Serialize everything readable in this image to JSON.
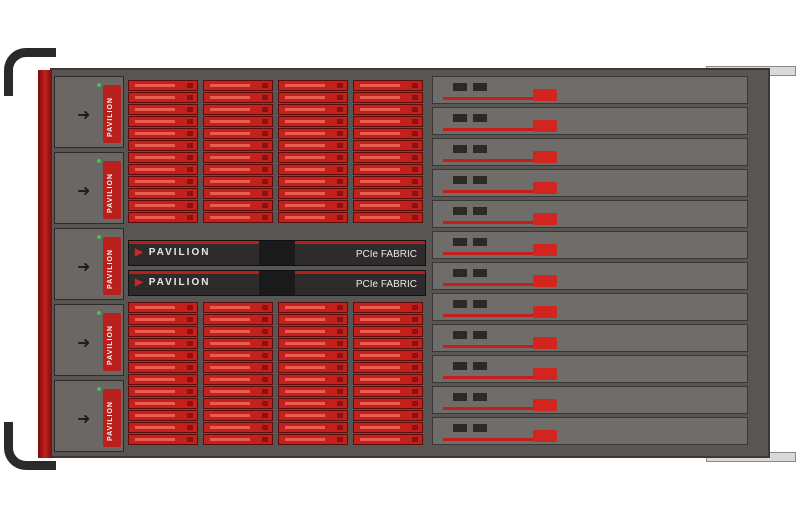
{
  "psu_label": "PAVILION",
  "fabric_modules": [
    {
      "brand": "PAVILION",
      "name": "PCIe FABRIC"
    },
    {
      "brand": "PAVILION",
      "name": "PCIe FABRIC"
    }
  ],
  "colors": {
    "accent": "#c3201d",
    "chassis": "#595552",
    "fabric": "#2d2b2b"
  }
}
